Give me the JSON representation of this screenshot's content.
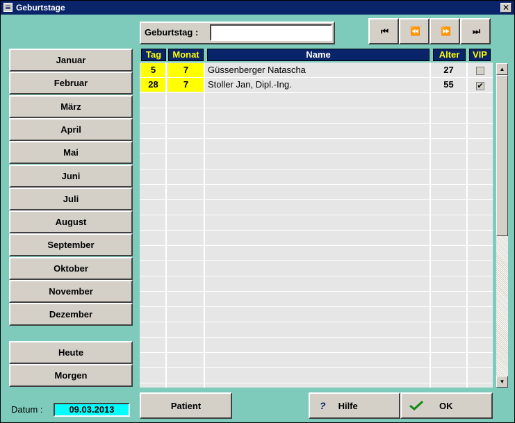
{
  "window": {
    "title": "Geburtstage",
    "close_glyph": "✕"
  },
  "search": {
    "label": "Geburtstag :",
    "value": ""
  },
  "nav": {
    "first": "⏮",
    "prev": "⏪",
    "next": "⏩",
    "last": "⏭"
  },
  "months": [
    "Januar",
    "Februar",
    "März",
    "April",
    "Mai",
    "Juni",
    "Juli",
    "August",
    "September",
    "Oktober",
    "November",
    "Dezember"
  ],
  "quick": {
    "today": "Heute",
    "tomorrow": "Morgen"
  },
  "datum": {
    "label": "Datum :",
    "value": "09.03.2013"
  },
  "table": {
    "headers": {
      "tag": "Tag",
      "monat": "Monat",
      "name": "Name",
      "alter": "Alter",
      "vip": "VIP"
    },
    "rows": [
      {
        "tag": "5",
        "monat": "7",
        "name": "Güssenberger Natascha",
        "alter": "27",
        "vip": false
      },
      {
        "tag": "28",
        "monat": "7",
        "name": "Stoller Jan, Dipl.-Ing.",
        "alter": "55",
        "vip": true
      }
    ]
  },
  "buttons": {
    "patient": "Patient",
    "hilfe": "Hilfe",
    "ok": "OK"
  },
  "colors": {
    "background": "#7ecbbb",
    "header": "#0a246a",
    "highlight": "#ffff00",
    "datum": "#00ffff"
  },
  "icons": {
    "help": "question-icon",
    "ok": "checkmark-icon"
  }
}
